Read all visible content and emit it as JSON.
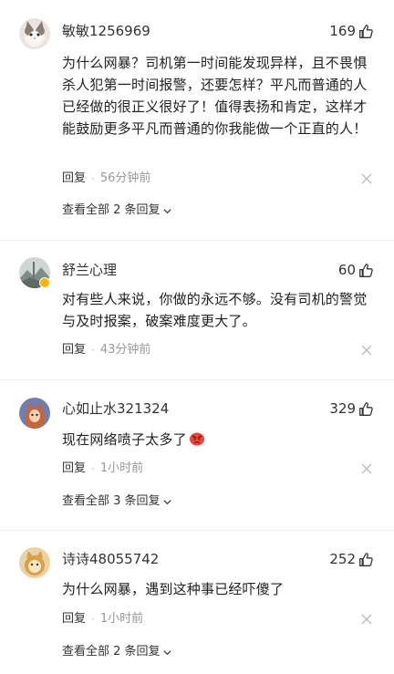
{
  "comments": [
    {
      "username": "敏敏1256969",
      "likes": "169",
      "content": "为什么网暴？司机第一时间能发现异样，且不畏惧杀人犯第一时间报警，还要怎样？平凡而普通的人已经做的很正义很好了！值得表扬和肯定，这样才能鼓励更多平凡而普通的你我能做一个正直的人！",
      "reply": "回复",
      "sep": "·",
      "time": "56分钟前",
      "view_replies": "查看全部 2 条回复"
    },
    {
      "username": "舒兰心理",
      "likes": "60",
      "content": "对有些人来说，你做的永远不够。没有司机的警觉与及时报案，破案难度更大了。",
      "reply": "回复",
      "sep": "·",
      "time": "43分钟前"
    },
    {
      "username": "心如止水321324",
      "likes": "329",
      "content": "现在网络喷子太多了",
      "emoji": "angry-face",
      "reply": "回复",
      "sep": "·",
      "time": "1小时前",
      "view_replies": "查看全部 3 条回复"
    },
    {
      "username": "诗诗48055742",
      "likes": "252",
      "content": "为什么网暴，遇到这种事已经吓傻了",
      "reply": "回复",
      "sep": "·",
      "time": "1小时前",
      "view_replies": "查看全部 2 条回复"
    }
  ],
  "icons": {
    "like": "thumbs-up-icon",
    "close": "close-icon",
    "expand": "chevron-down-icon",
    "verified": "verified-badge-icon"
  },
  "colors": {
    "text": "#222222",
    "time": "#999999",
    "icon_gray": "#bbbbbb",
    "badge": "#ffb400",
    "emoji": "#e8453c"
  }
}
